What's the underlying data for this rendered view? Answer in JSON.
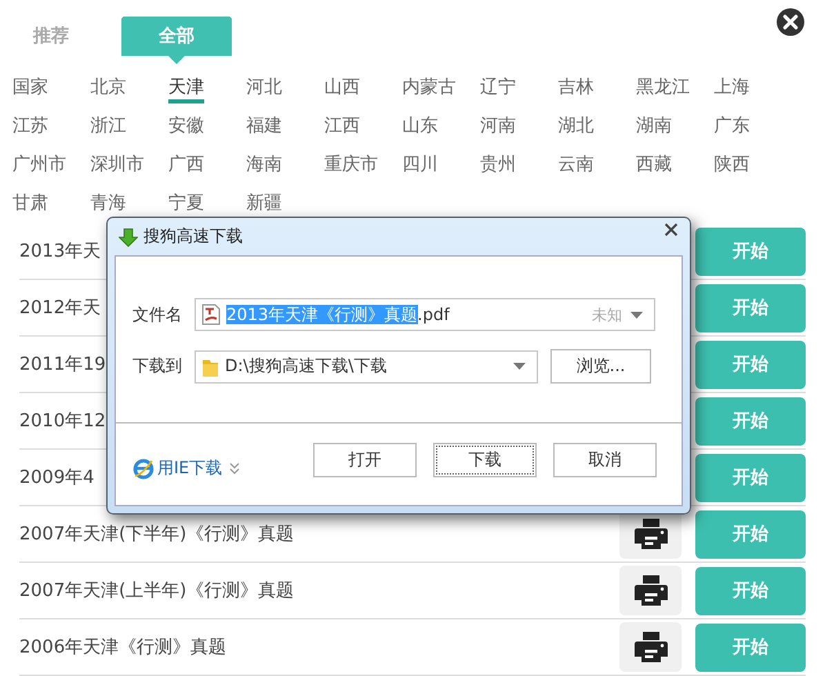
{
  "tabs": [
    {
      "label": "推荐",
      "selected": false
    },
    {
      "label": "全部",
      "selected": true
    }
  ],
  "regions": [
    {
      "label": "国家",
      "selected": false
    },
    {
      "label": "北京",
      "selected": false
    },
    {
      "label": "天津",
      "selected": true
    },
    {
      "label": "河北",
      "selected": false
    },
    {
      "label": "山西",
      "selected": false
    },
    {
      "label": "内蒙古",
      "selected": false
    },
    {
      "label": "辽宁",
      "selected": false
    },
    {
      "label": "吉林",
      "selected": false
    },
    {
      "label": "黑龙江",
      "selected": false
    },
    {
      "label": "上海",
      "selected": false
    },
    {
      "label": "江苏",
      "selected": false
    },
    {
      "label": "浙江",
      "selected": false
    },
    {
      "label": "安徽",
      "selected": false
    },
    {
      "label": "福建",
      "selected": false
    },
    {
      "label": "江西",
      "selected": false
    },
    {
      "label": "山东",
      "selected": false
    },
    {
      "label": "河南",
      "selected": false
    },
    {
      "label": "湖北",
      "selected": false
    },
    {
      "label": "湖南",
      "selected": false
    },
    {
      "label": "广东",
      "selected": false
    },
    {
      "label": "广州市",
      "selected": false
    },
    {
      "label": "深圳市",
      "selected": false
    },
    {
      "label": "广西",
      "selected": false
    },
    {
      "label": "海南",
      "selected": false
    },
    {
      "label": "重庆市",
      "selected": false
    },
    {
      "label": "四川",
      "selected": false
    },
    {
      "label": "贵州",
      "selected": false
    },
    {
      "label": "云南",
      "selected": false
    },
    {
      "label": "西藏",
      "selected": false
    },
    {
      "label": "陕西",
      "selected": false
    },
    {
      "label": "甘肃",
      "selected": false
    },
    {
      "label": "青海",
      "selected": false
    },
    {
      "label": "宁夏",
      "selected": false
    },
    {
      "label": "新疆",
      "selected": false
    }
  ],
  "rows": [
    {
      "title": "2013年天",
      "action": "开始",
      "print_button": false
    },
    {
      "title": "2012年天",
      "action": "开始",
      "print_button": false
    },
    {
      "title": "2011年19",
      "action": "开始",
      "print_button": false
    },
    {
      "title": "2010年12",
      "action": "开始",
      "print_button": false
    },
    {
      "title": "2009年4",
      "action": "开始",
      "print_button": false
    },
    {
      "title": "2007年天津(下半年)《行测》真题",
      "action": "开始",
      "print_button": true
    },
    {
      "title": "2007年天津(上半年)《行测》真题",
      "action": "开始",
      "print_button": true
    },
    {
      "title": "2006年天津《行测》真题",
      "action": "开始",
      "print_button": true
    }
  ],
  "dialog": {
    "title": "搜狗高速下载",
    "file_label": "文件名",
    "file_name": "2013年天津《行测》真题",
    "file_extension": ".pdf",
    "name_selected": true,
    "file_size": "未知",
    "folder_label": "下载到",
    "folder": "D:\\搜狗高速下载\\下载",
    "browse": "浏览...",
    "ie_link": "用IE下载",
    "buttons": [
      {
        "label": "打开",
        "focused": false
      },
      {
        "label": "下载",
        "focused": true
      },
      {
        "label": "取消",
        "focused": false
      }
    ]
  }
}
